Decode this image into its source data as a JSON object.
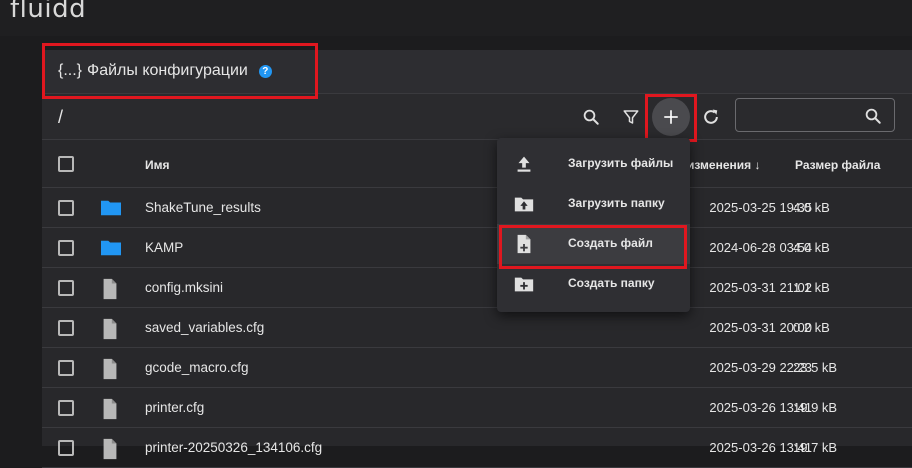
{
  "app": {
    "logo": "fluidd"
  },
  "card": {
    "title_prefix": "{...}",
    "title": "Файлы конфигурации",
    "help_icon": "?"
  },
  "toolbar": {
    "path": "/",
    "search_placeholder": "",
    "icons": [
      "search-icon",
      "filter-icon",
      "add-icon",
      "refresh-icon"
    ]
  },
  "table": {
    "headers": {
      "name": "Имя",
      "modified": "изменения",
      "size": "Размер файла"
    },
    "rows": [
      {
        "type": "folder",
        "name": "ShakeTune_results",
        "date": "2025-03-25 19:35",
        "size": "4.0 kB"
      },
      {
        "type": "folder",
        "name": "KAMP",
        "date": "2024-06-28 03:54",
        "size": "4.0 kB"
      },
      {
        "type": "file",
        "name": "config.mksini",
        "date": "2025-03-31 21:02",
        "size": "1.1 kB"
      },
      {
        "type": "file",
        "name": "saved_variables.cfg",
        "date": "2025-03-31 20:00",
        "size": "0.2 kB"
      },
      {
        "type": "file",
        "name": "gcode_macro.cfg",
        "date": "2025-03-29 22:23",
        "size": "23.5 kB"
      },
      {
        "type": "file",
        "name": "printer.cfg",
        "date": "2025-03-26 13:41",
        "size": "19.9 kB"
      },
      {
        "type": "file",
        "name": "printer-20250326_134106.cfg",
        "date": "2025-03-26 13:41",
        "size": "19.7 kB"
      }
    ]
  },
  "menu": {
    "items": [
      {
        "label": "Загрузить файлы",
        "icon": "upload-icon"
      },
      {
        "label": "Загрузить папку",
        "icon": "folder-upload-icon"
      },
      {
        "label": "Создать файл",
        "icon": "file-plus-icon"
      },
      {
        "label": "Создать папку",
        "icon": "folder-plus-icon"
      }
    ]
  },
  "colors": {
    "accent": "#2196f3",
    "highlight": "#e0171f",
    "background": "#1c1c1e",
    "card": "#28282b"
  }
}
